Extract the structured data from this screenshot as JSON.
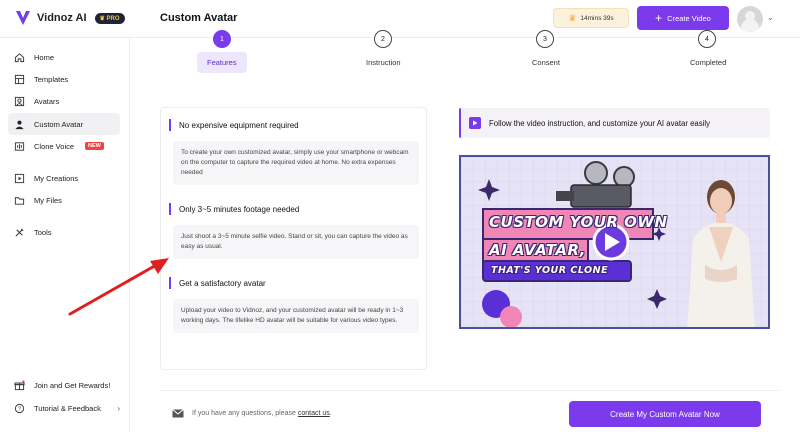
{
  "app": {
    "brand": "Vidnoz AI",
    "pro_badge": "PRO",
    "page_title": "Custom Avatar"
  },
  "topbar": {
    "time_remaining": "14mins 39s",
    "create_video_label": "Create Video"
  },
  "sidebar": {
    "items": [
      {
        "label": "Home",
        "icon": "home-icon"
      },
      {
        "label": "Templates",
        "icon": "templates-icon"
      },
      {
        "label": "Avatars",
        "icon": "avatars-icon"
      },
      {
        "label": "Custom Avatar",
        "icon": "custom-avatar-icon",
        "active": true
      },
      {
        "label": "Clone Voice",
        "icon": "clone-voice-icon",
        "badge": "NEW"
      },
      {
        "label": "My Creations",
        "icon": "creations-icon"
      },
      {
        "label": "My Files",
        "icon": "files-icon"
      },
      {
        "label": "Tools",
        "icon": "tools-icon"
      }
    ],
    "footer": [
      {
        "label": "Join and Get Rewards!",
        "icon": "gift-icon"
      },
      {
        "label": "Tutorial & Feedback",
        "icon": "help-icon"
      }
    ]
  },
  "stepper": {
    "steps": [
      {
        "label": "Features",
        "num": "1",
        "active": true
      },
      {
        "label": "Instruction",
        "num": "2"
      },
      {
        "label": "Consent",
        "num": "3"
      },
      {
        "label": "Completed",
        "num": "4"
      }
    ]
  },
  "features": [
    {
      "title": "No expensive equipment required",
      "body": "To create your own customized avatar, simply use your smartphone or webcam on the computer to capture the required video at home. No extra expenses needed"
    },
    {
      "title": "Only 3~5 minutes footage needed",
      "body": "Just shoot a 3~5 minute selfie video. Stand or sit, you can capture the video as easy as usual."
    },
    {
      "title": "Get a satisfactory avatar",
      "body": "Upload your video to Vidnoz, and your customized avatar will be ready in 1~3 working days. The lifelike HD avatar will be suitable for various video types."
    }
  ],
  "video": {
    "hint": "Follow the video instruction, and customize your AI avatar easily",
    "banner_line1": "CUSTOM YOUR OWN",
    "banner_line2": "AI AVATAR,",
    "banner_line3": "THAT'S YOUR CLONE"
  },
  "bottom": {
    "question_text": "If you have any questions, please",
    "contact_link": "contact us",
    "period": ".",
    "cta_label": "Create My Custom Avatar Now"
  },
  "colors": {
    "accent": "#7c3aed",
    "new_badge": "#ef4444",
    "arrow": "#e02020"
  }
}
